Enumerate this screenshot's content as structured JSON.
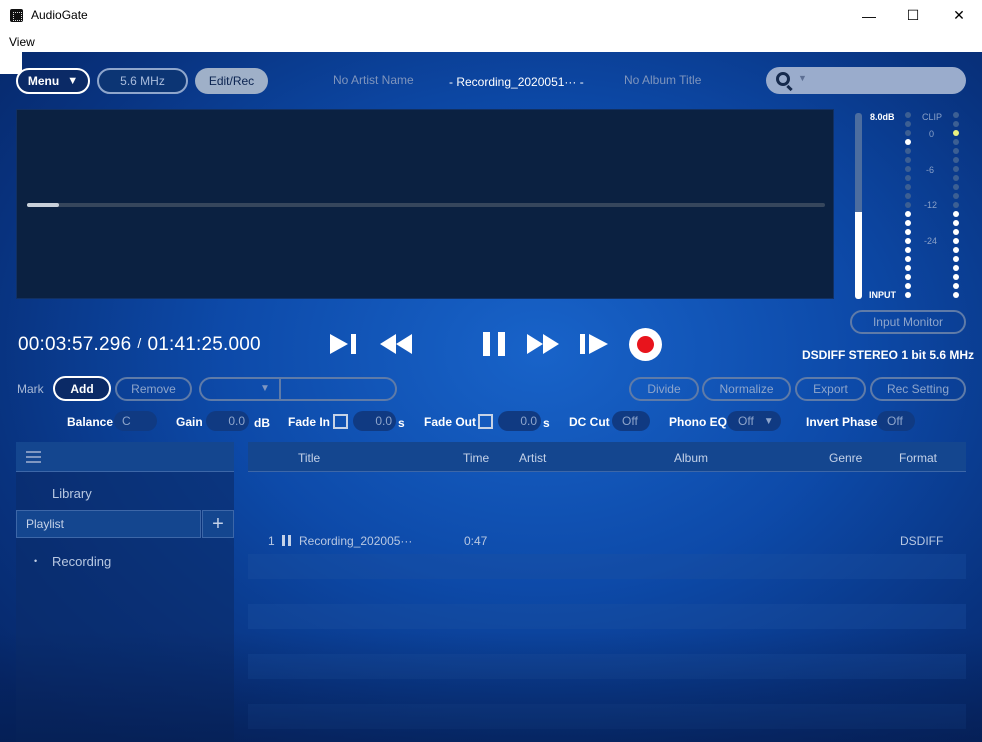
{
  "window": {
    "title": "AudioGate",
    "menu_view": "View",
    "controls": {
      "minimize": "—",
      "maximize": "☐",
      "close": "✕"
    }
  },
  "toolbar": {
    "menu_label": "Menu",
    "menu_caret": "▼",
    "frequency": "5.6 MHz",
    "edit_rec": "Edit/Rec",
    "artist": "No Artist Name",
    "track_title": "-  Recording_2020051···  -",
    "album": "No Album Title",
    "search_caret": "▼",
    "search_value": ""
  },
  "waveform": {
    "progress_fraction": 0.04
  },
  "meter": {
    "db_label": "8.0dB",
    "input_label": "INPUT",
    "input_level_fraction": 0.47,
    "scale": [
      "CLIP",
      "0",
      "-6",
      "-12",
      "-24"
    ]
  },
  "input_monitor": "Input Monitor",
  "transport": {
    "current_time": "00:03:57.296",
    "separator": "/",
    "total_time": "01:41:25.000",
    "format": "DSDIFF STEREO 1 bit 5.6 MHz"
  },
  "mark": {
    "label": "Mark",
    "add": "Add",
    "remove": "Remove",
    "selector_caret": "▼",
    "selector_value": ""
  },
  "edit_buttons": {
    "divide": "Divide",
    "normalize": "Normalize",
    "export": "Export",
    "rec_setting": "Rec Setting"
  },
  "params": {
    "balance_label": "Balance",
    "balance_value": "C",
    "gain_label": "Gain",
    "gain_value": "0.0",
    "gain_unit": "dB",
    "fade_in_label": "Fade In",
    "fade_in_value": "0.0",
    "fade_in_unit": "s",
    "fade_out_label": "Fade Out",
    "fade_out_value": "0.0",
    "fade_out_unit": "s",
    "dc_cut_label": "DC Cut",
    "dc_cut_value": "Off",
    "phono_eq_label": "Phono EQ",
    "phono_eq_value": "Off",
    "phono_eq_caret": "▼",
    "invert_phase_label": "Invert Phase",
    "invert_phase_value": "Off"
  },
  "sidebar": {
    "library": "Library",
    "playlist": "Playlist",
    "add_playlist": "+",
    "playlists": [
      "Recording"
    ],
    "bullet": "•"
  },
  "tracklist": {
    "columns": [
      "Title",
      "Time",
      "Artist",
      "Album",
      "Genre",
      "Format"
    ],
    "rows": [
      {
        "index": "1",
        "title": "Recording_202005···",
        "time": "0:47",
        "artist": "",
        "album": "",
        "genre": "",
        "format": "DSDIFF"
      }
    ]
  }
}
